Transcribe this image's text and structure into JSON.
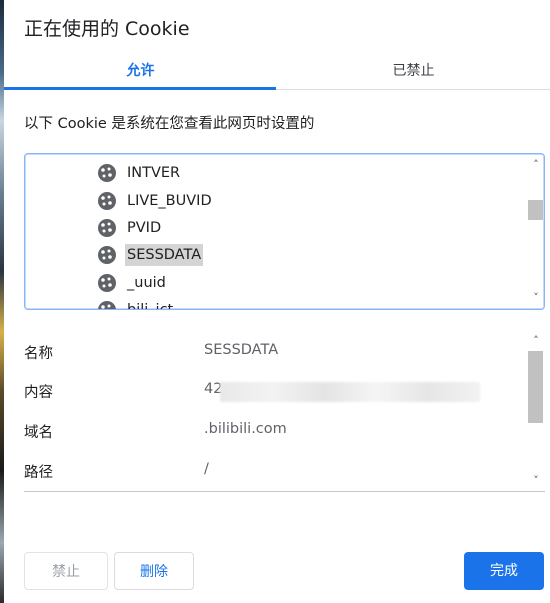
{
  "dialog": {
    "title": "正在使用的 Cookie",
    "tabs": [
      {
        "label": "允许"
      },
      {
        "label": "已禁止"
      }
    ],
    "description": "以下 Cookie 是系统在您查看此网页时设置的"
  },
  "cookies": [
    {
      "name": "INTVER"
    },
    {
      "name": "LIVE_BUVID"
    },
    {
      "name": "PVID"
    },
    {
      "name": "SESSDATA"
    },
    {
      "name": "_uuid"
    },
    {
      "name": "bili_jct"
    }
  ],
  "details": {
    "name_label": "名称",
    "name_value": "SESSDATA",
    "content_label": "内容",
    "content_value": "42",
    "domain_label": "域名",
    "domain_value": ".bilibili.com",
    "path_label": "路径",
    "path_value": "/"
  },
  "buttons": {
    "block": "禁止",
    "delete": "删除",
    "done": "完成"
  },
  "icons": {
    "cookie": "cookie-icon",
    "scroll_up": "chevron-up-icon",
    "scroll_down": "chevron-down-icon"
  },
  "colors": {
    "accent": "#1a73e8",
    "selection": "#d4d4d4"
  }
}
